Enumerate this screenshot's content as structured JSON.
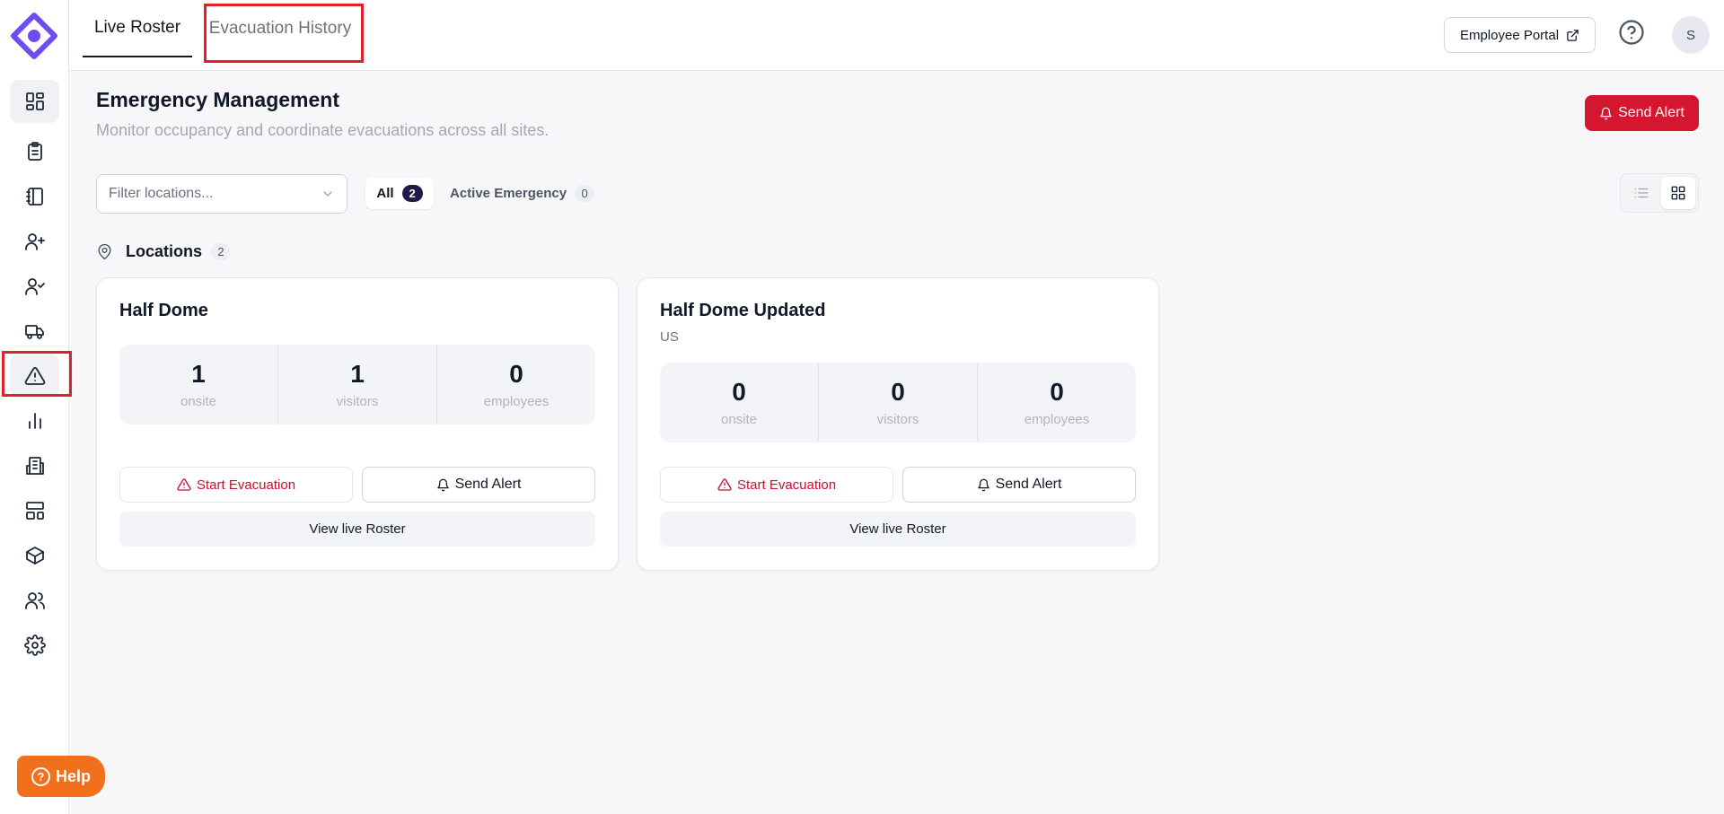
{
  "topbar": {
    "tabs": [
      {
        "label": "Live Roster",
        "active": true
      },
      {
        "label": "Evacuation History",
        "active": false
      }
    ],
    "employee_portal_label": "Employee Portal",
    "avatar_initial": "S"
  },
  "sidebar": {
    "items": [
      {
        "icon": "dashboard-icon",
        "active": false
      },
      {
        "icon": "clipboard-icon",
        "active": false
      },
      {
        "icon": "notebook-icon",
        "active": false
      },
      {
        "icon": "user-plus-icon",
        "active": false
      },
      {
        "icon": "user-check-icon",
        "active": false
      },
      {
        "icon": "truck-icon",
        "active": false
      },
      {
        "icon": "warning-triangle-icon",
        "active": true
      },
      {
        "icon": "bar-chart-icon",
        "active": false
      },
      {
        "icon": "building-icon",
        "active": false
      },
      {
        "icon": "layout-icon",
        "active": false
      },
      {
        "icon": "package-icon",
        "active": false
      },
      {
        "icon": "users-icon",
        "active": false
      },
      {
        "icon": "settings-icon",
        "active": false
      }
    ],
    "help_label": "Help"
  },
  "page": {
    "title": "Emergency Management",
    "subtitle": "Monitor occupancy and coordinate evacuations across all sites.",
    "send_alert_label": "Send Alert"
  },
  "filters": {
    "placeholder": "Filter locations...",
    "all_label": "All",
    "all_count": "2",
    "active_label": "Active Emergency",
    "active_count": "0"
  },
  "locations": {
    "label": "Locations",
    "count": "2",
    "cards": [
      {
        "name": "Half Dome",
        "subtitle": "",
        "stats": [
          {
            "value": "1",
            "label": "onsite"
          },
          {
            "value": "1",
            "label": "visitors"
          },
          {
            "value": "0",
            "label": "employees"
          }
        ],
        "start_evacuation_label": "Start Evacuation",
        "send_alert_label": "Send Alert",
        "view_roster_label": "View live Roster"
      },
      {
        "name": "Half Dome Updated",
        "subtitle": "US",
        "stats": [
          {
            "value": "0",
            "label": "onsite"
          },
          {
            "value": "0",
            "label": "visitors"
          },
          {
            "value": "0",
            "label": "employees"
          }
        ],
        "start_evacuation_label": "Start Evacuation",
        "send_alert_label": "Send Alert",
        "view_roster_label": "View live Roster"
      }
    ]
  },
  "colors": {
    "brand": "#6d4cf0",
    "danger": "#d4172f",
    "help": "#f2701c",
    "highlight_box": "#e0202a"
  }
}
